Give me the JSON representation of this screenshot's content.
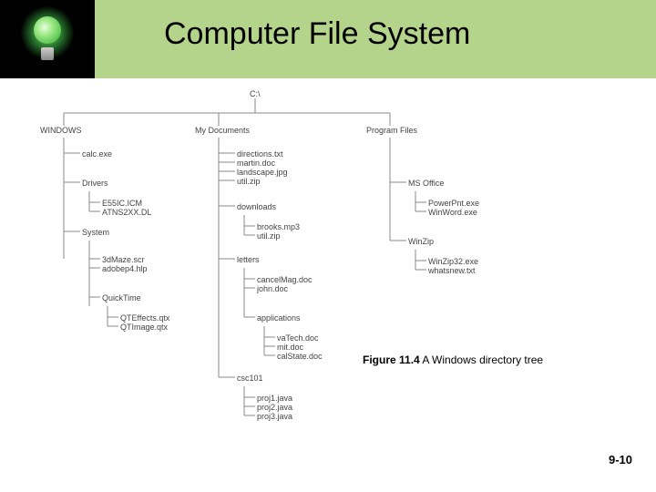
{
  "header": {
    "title": "Computer File System",
    "icon": "lightbulb-icon"
  },
  "caption": {
    "bold": "Figure 11.4",
    "rest": " A Windows directory tree"
  },
  "pagenum": "9-10",
  "tree": {
    "root": "C:\\",
    "windows": {
      "label": "WINDOWS",
      "calc": "calc.exe",
      "drivers": {
        "label": "Drivers",
        "files": [
          "E55IC.ICM",
          "ATNS2XX.DL"
        ]
      },
      "system": {
        "label": "System",
        "files": [
          "3dMaze.scr",
          "adobep4.hlp"
        ],
        "quicktime": {
          "label": "QuickTime",
          "files": [
            "QTEffects.qtx",
            "QTImage.qtx"
          ]
        }
      }
    },
    "mydocs": {
      "label": "My Documents",
      "files": [
        "directions.txt",
        "martin.doc",
        "landscape.jpg",
        "util.zip"
      ],
      "downloads": {
        "label": "downloads",
        "files": [
          "brooks.mp3",
          "util.zip"
        ]
      },
      "letters": {
        "label": "letters",
        "files": [
          "cancelMag.doc",
          "john.doc"
        ],
        "applications": {
          "label": "applications",
          "files": [
            "vaTech.doc",
            "mit.doc",
            "calState.doc"
          ]
        }
      },
      "csc101": {
        "label": "csc101",
        "files": [
          "proj1.java",
          "proj2.java",
          "proj3.java"
        ]
      }
    },
    "progfiles": {
      "label": "Program Files",
      "msoffice": {
        "label": "MS Office",
        "files": [
          "PowerPnt.exe",
          "WinWord.exe"
        ]
      },
      "winzip": {
        "label": "WinZip",
        "files": [
          "WinZip32.exe",
          "whatsnew.txt"
        ]
      }
    }
  }
}
